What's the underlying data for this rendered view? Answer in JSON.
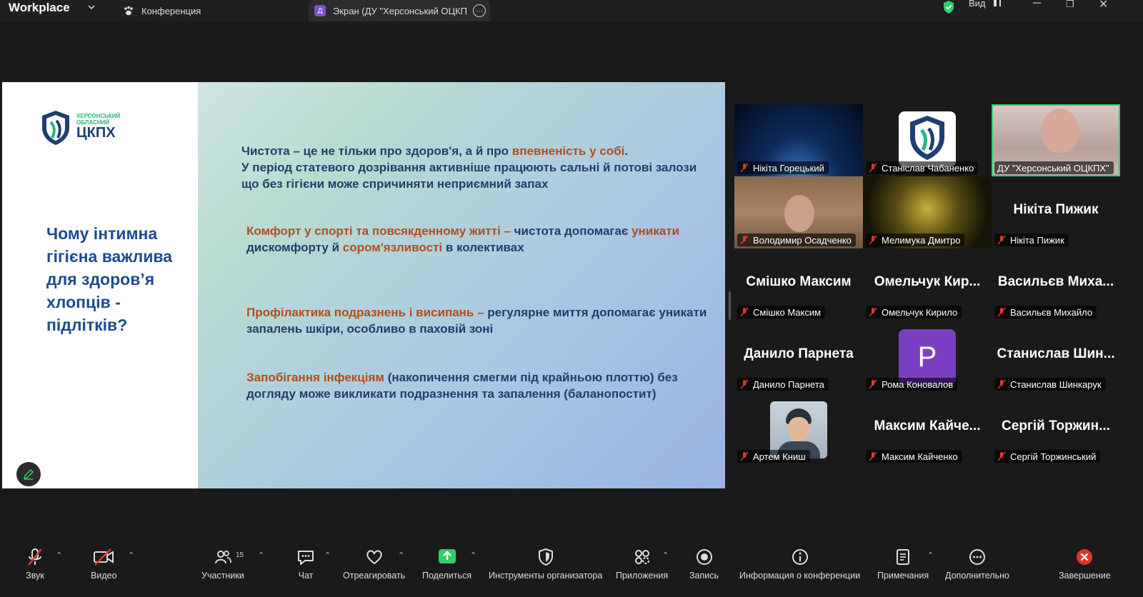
{
  "app": {
    "brand_small": "zoom",
    "brand": "Workplace"
  },
  "tabs": [
    {
      "label": "Конференция"
    },
    {
      "label": "Экран (ДУ \"Херсонський ОЦКП"
    }
  ],
  "view_label": "Вид",
  "slide": {
    "logo_small_1": "ХЕРСОНСЬКИЙ",
    "logo_small_2": "ОБЛАСНИЙ",
    "logo_big": "ЦКПХ",
    "title": "Чому інтимна гігієна важлива для здоров’я хлопців - підлітків?",
    "p1_a": "Чистота – це не тільки про здоров'я, а й про ",
    "p1_hl": "впевненість у собі",
    "p1_b": ".",
    "p1_c": "У період статевого дозрівання  активніше працюють сальні й потові залози що без гігієни може спричиняти неприємний запах",
    "p2_hl1": "Комфорт у спорті та повсякденному житті –",
    "p2_a": " чистота допомагає ",
    "p2_hl2": "уникати",
    "p2_b": " дискомфорту й ",
    "p2_hl3": "сором'язливості",
    "p2_c": " в колективах",
    "p3_hl": "Профілактика подразнень і висипань –",
    "p3_a": " регулярне миття допомагає  уникати запалень шкіри, особливо в паховій зоні",
    "p4_hl": "Запобігання інфекціям",
    "p4_a": "  (накопичення  смегми під крайньою плоттю) без догляду може викликати подразнення та запалення (баланопостит)"
  },
  "participants": [
    {
      "label": "Нікіта Горецький",
      "big": ""
    },
    {
      "label": "Станіслав Чабаненко",
      "big": ""
    },
    {
      "label": "ДУ \"Херсонський ОЦКПХ\"",
      "big": ""
    },
    {
      "label": "Володимир Осадченко",
      "big": ""
    },
    {
      "label": "Мелимука Дмитро",
      "big": ""
    },
    {
      "label": "Нікіта Пижик",
      "big": "Нікіта Пижик"
    },
    {
      "label": "Смішко Максим",
      "big": "Смішко Максим"
    },
    {
      "label": "Омельчук Кирило",
      "big": "Омельчук  Кир..."
    },
    {
      "label": "Васильєв Михайло",
      "big": "Васильєв  Миха..."
    },
    {
      "label": "Данило Парнета",
      "big": "Данило Парнета"
    },
    {
      "label": "Рома Коновалов",
      "big": "P"
    },
    {
      "label": "Станислав Шинкарук",
      "big": "Станислав  Шин..."
    },
    {
      "label": "Артем Книш",
      "big": ""
    },
    {
      "label": "Максим Кайченко",
      "big": "Максим  Кайче..."
    },
    {
      "label": "Сергій Торжинський",
      "big": "Сергій  Торжин..."
    }
  ],
  "toolbar": {
    "audio": "Звук",
    "video": "Видео",
    "participants": "Участники",
    "participants_count": "15",
    "chat": "Чат",
    "react": "Отреагировать",
    "share": "Поделиться",
    "host_tools": "Инструменты организатора",
    "apps": "Приложения",
    "record": "Запись",
    "info": "Информация о конференции",
    "notes": "Примечания",
    "more": "Дополнительно",
    "end": "Завершение"
  }
}
